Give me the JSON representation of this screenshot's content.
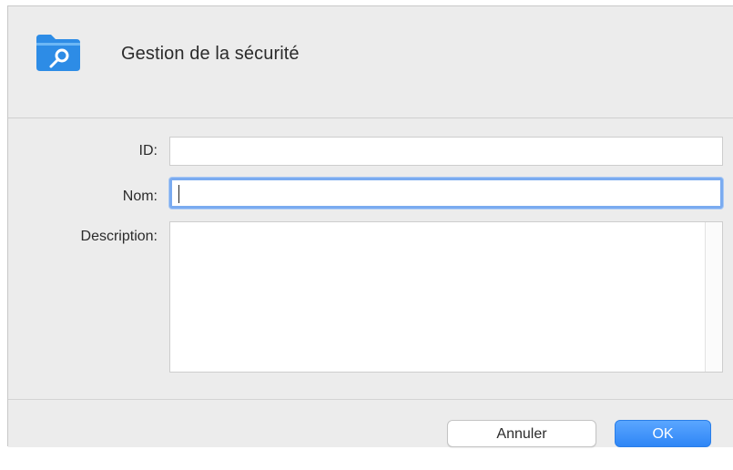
{
  "dialog": {
    "title": "Gestion de la sécurité",
    "icon": "folder-key-icon",
    "accent_color": "#2f86f6"
  },
  "form": {
    "id_label": "ID:",
    "id_value": "",
    "name_label": "Nom:",
    "name_value": "",
    "description_label": "Description:",
    "description_value": ""
  },
  "buttons": {
    "cancel_label": "Annuler",
    "ok_label": "OK"
  }
}
